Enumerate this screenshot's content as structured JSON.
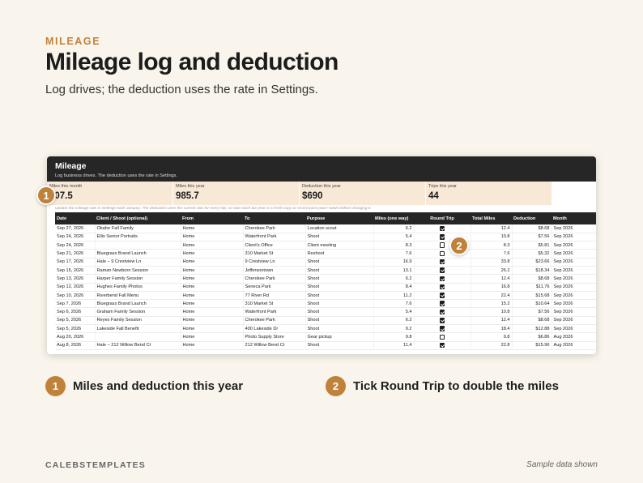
{
  "header": {
    "kicker": "MILEAGE",
    "title": "Mileage log and deduction",
    "subtitle": "Log drives; the deduction uses the rate in Settings."
  },
  "sheet": {
    "title": "Mileage",
    "subtitle": "Log business drives. The deduction uses the rate in Settings.",
    "stats": [
      {
        "label": "Miles this month",
        "value": "207.5"
      },
      {
        "label": "Miles this year",
        "value": "985.7"
      },
      {
        "label": "Deduction this year",
        "value": "$690"
      },
      {
        "label": "Trips this year",
        "value": "44"
      }
    ],
    "note": "Update the mileage rate in Settings each January. The deduction uses the current rate for every trip, so start each tax year in a fresh copy or record past years' totals before changing it.",
    "columns": [
      "Date",
      "Client / Shoot (optional)",
      "From",
      "To",
      "Purpose",
      "Miles (one way)",
      "Round Trip",
      "Total Miles",
      "Deduction",
      "Month"
    ],
    "rows": [
      {
        "date": "Sep 27, 2026",
        "client": "Okafor Fall Family",
        "from": "Home",
        "to": "Cherokee Park",
        "purpose": "Location scout",
        "miles": "6.2",
        "round": true,
        "total": "12.4",
        "deduction": "$8.68",
        "month": "Sep 2026"
      },
      {
        "date": "Sep 24, 2026",
        "client": "Ellis Senior Portraits",
        "from": "Home",
        "to": "Waterfront Park",
        "purpose": "Shoot",
        "miles": "5.4",
        "round": true,
        "total": "10.8",
        "deduction": "$7.56",
        "month": "Sep 2026"
      },
      {
        "date": "Sep 24, 2026",
        "client": "",
        "from": "Home",
        "to": "Client's Office",
        "purpose": "Client meeting",
        "miles": "8.3",
        "round": false,
        "total": "8.3",
        "deduction": "$5.81",
        "month": "Sep 2026"
      },
      {
        "date": "Sep 21, 2026",
        "client": "Bluegrass Brand Launch",
        "from": "Home",
        "to": "310 Market St",
        "purpose": "Reshoot",
        "miles": "7.6",
        "round": false,
        "total": "7.6",
        "deduction": "$5.32",
        "month": "Sep 2026"
      },
      {
        "date": "Sep 17, 2026",
        "client": "Hale – 9 Crestview Ln",
        "from": "Home",
        "to": "9 Crestview Ln",
        "purpose": "Shoot",
        "miles": "16.9",
        "round": true,
        "total": "33.8",
        "deduction": "$23.66",
        "month": "Sep 2026"
      },
      {
        "date": "Sep 15, 2026",
        "client": "Raman Newborn Session",
        "from": "Home",
        "to": "Jeffersontown",
        "purpose": "Shoot",
        "miles": "13.1",
        "round": true,
        "total": "26.2",
        "deduction": "$18.34",
        "month": "Sep 2026"
      },
      {
        "date": "Sep 13, 2026",
        "client": "Harper Family Session",
        "from": "Home",
        "to": "Cherokee Park",
        "purpose": "Shoot",
        "miles": "6.2",
        "round": true,
        "total": "12.4",
        "deduction": "$8.68",
        "month": "Sep 2026"
      },
      {
        "date": "Sep 12, 2026",
        "client": "Hughes Family Photos",
        "from": "Home",
        "to": "Seneca Park",
        "purpose": "Shoot",
        "miles": "8.4",
        "round": true,
        "total": "16.8",
        "deduction": "$11.76",
        "month": "Sep 2026"
      },
      {
        "date": "Sep 10, 2026",
        "client": "Riverbend Fall Menu",
        "from": "Home",
        "to": "77 River Rd",
        "purpose": "Shoot",
        "miles": "11.2",
        "round": true,
        "total": "22.4",
        "deduction": "$15.68",
        "month": "Sep 2026"
      },
      {
        "date": "Sep 7, 2026",
        "client": "Bluegrass Brand Launch",
        "from": "Home",
        "to": "310 Market St",
        "purpose": "Shoot",
        "miles": "7.6",
        "round": true,
        "total": "15.2",
        "deduction": "$10.64",
        "month": "Sep 2026"
      },
      {
        "date": "Sep 6, 2026",
        "client": "Graham Family Session",
        "from": "Home",
        "to": "Waterfront Park",
        "purpose": "Shoot",
        "miles": "5.4",
        "round": true,
        "total": "10.8",
        "deduction": "$7.56",
        "month": "Sep 2026"
      },
      {
        "date": "Sep 5, 2026",
        "client": "Reyes Family Session",
        "from": "Home",
        "to": "Cherokee Park",
        "purpose": "Shoot",
        "miles": "6.2",
        "round": true,
        "total": "12.4",
        "deduction": "$8.68",
        "month": "Sep 2026"
      },
      {
        "date": "Sep 5, 2026",
        "client": "Lakeside Fall Benefit",
        "from": "Home",
        "to": "400 Lakeside Dr",
        "purpose": "Shoot",
        "miles": "9.2",
        "round": true,
        "total": "18.4",
        "deduction": "$12.88",
        "month": "Sep 2026"
      },
      {
        "date": "Aug 20, 2026",
        "client": "",
        "from": "Home",
        "to": "Photo Supply Store",
        "purpose": "Gear pickup",
        "miles": "9.8",
        "round": false,
        "total": "9.8",
        "deduction": "$6.86",
        "month": "Aug 2026"
      },
      {
        "date": "Aug 8, 2026",
        "client": "Hale – 212 Willow Bend Ct",
        "from": "Home",
        "to": "212 Willow Bend Ct",
        "purpose": "Shoot",
        "miles": "11.4",
        "round": true,
        "total": "22.8",
        "deduction": "$15.96",
        "month": "Aug 2026"
      }
    ]
  },
  "callouts": [
    {
      "number": "1",
      "text": "Miles and deduction this year"
    },
    {
      "number": "2",
      "text": "Tick Round Trip to double the miles"
    }
  ],
  "footer": {
    "brand": "CALEBSTEMPLATES",
    "note": "Sample data shown"
  },
  "colors": {
    "accent": "#c0813a",
    "background": "#f9f5ec",
    "header_dark": "#262626",
    "stat_fill": "#f7e9d6"
  }
}
